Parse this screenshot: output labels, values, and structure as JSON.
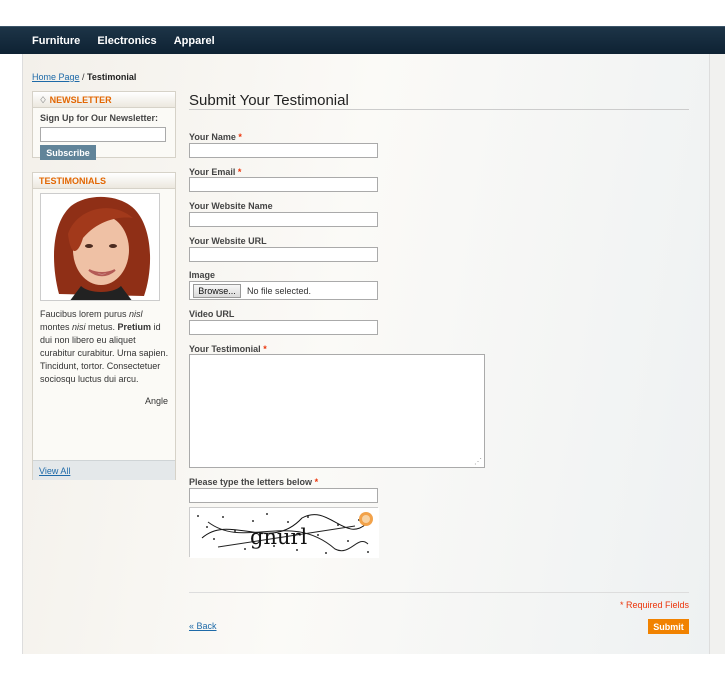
{
  "nav": [
    "Furniture",
    "Electronics",
    "Apparel"
  ],
  "breadcrumb": {
    "home": "Home Page",
    "sep": " / ",
    "current": "Testimonial"
  },
  "newsletter": {
    "title": "NEWSLETTER",
    "subtitle": "Sign Up for Our Newsletter:",
    "button": "Subscribe"
  },
  "testimonials": {
    "title": "TESTIMONIALS",
    "author": "Angle",
    "view_all": "View All"
  },
  "form": {
    "title": "Submit Your Testimonial",
    "name_label": "Your Name",
    "email_label": "Your Email",
    "website_name_label": "Your Website Name",
    "website_url_label": "Your Website URL",
    "image_label": "Image",
    "browse": "Browse...",
    "no_file": "No file selected.",
    "video_label": "Video URL",
    "testimonial_label": "Your Testimonial",
    "captcha_label": "Please type the letters below",
    "required_star": "*",
    "required_fields": "* Required Fields",
    "back": "« Back",
    "submit": "Submit"
  },
  "colors": {
    "accent": "#f18200",
    "link": "#1e6aa8",
    "required": "#eb340a",
    "nav_bg": "#12273a"
  }
}
